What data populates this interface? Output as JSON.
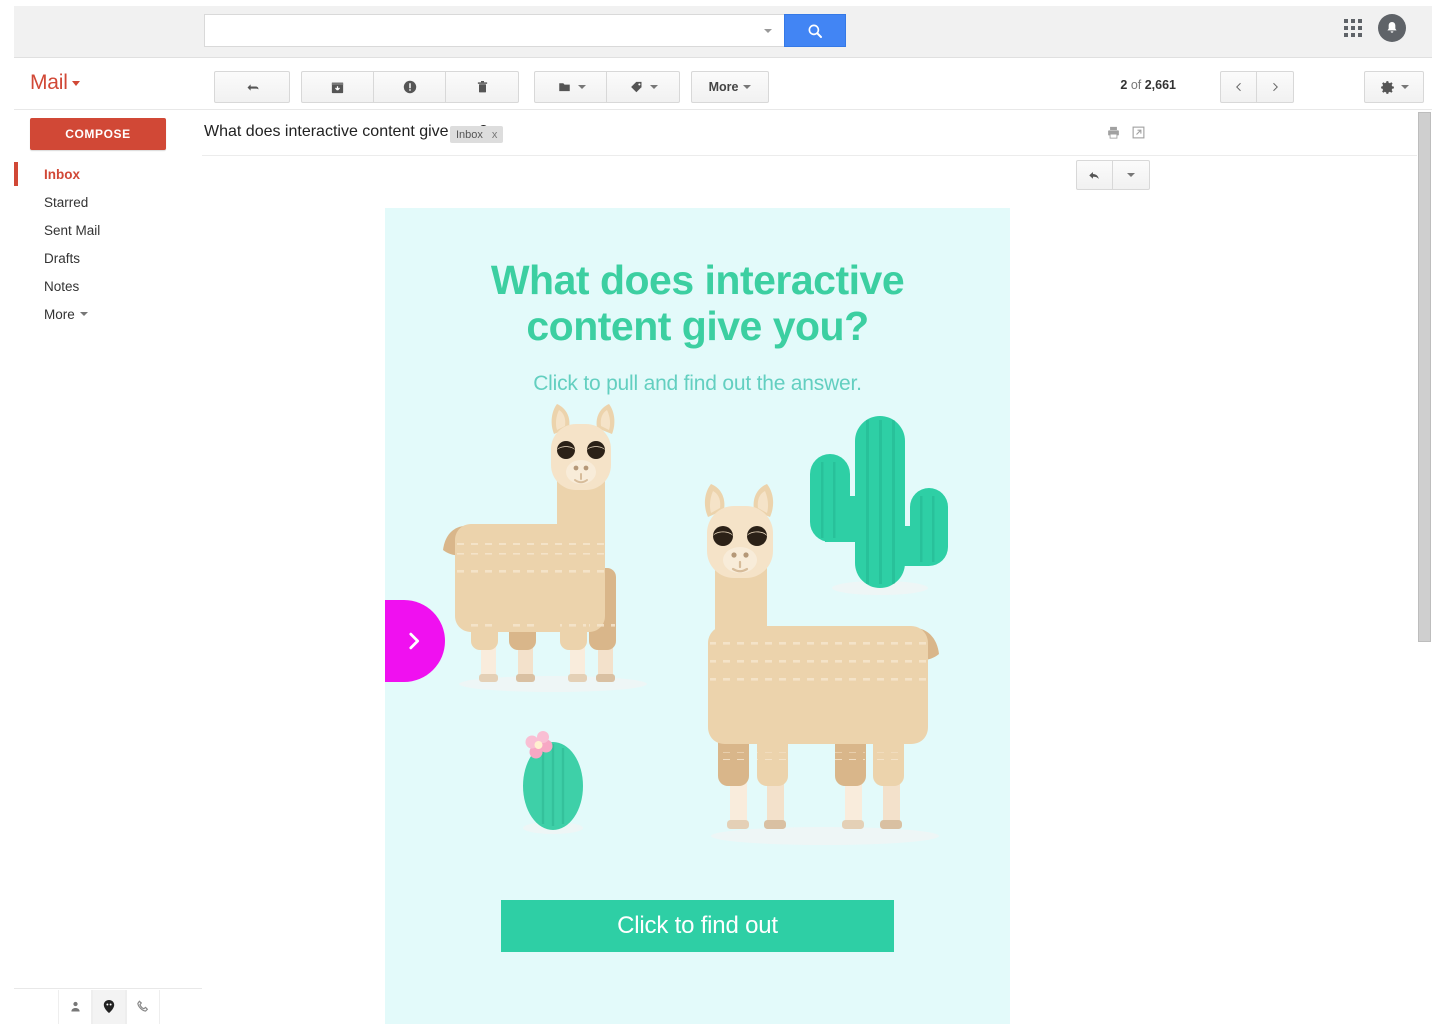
{
  "topbar": {
    "search_value": "",
    "search_placeholder": "",
    "search_button_icon": "search-icon",
    "apps_icon": "apps-grid-icon",
    "avatar_icon": "account-avatar-icon"
  },
  "mailbar": {
    "brand": "Mail",
    "buttons": [
      {
        "name": "back-to-inbox",
        "icon": "back-arrow-icon",
        "label": ""
      },
      {
        "name": "archive",
        "icon": "archive-icon",
        "label": ""
      },
      {
        "name": "report-spam",
        "icon": "exclamation-icon",
        "label": ""
      },
      {
        "name": "delete",
        "icon": "trash-icon",
        "label": ""
      },
      {
        "name": "move-to",
        "icon": "folder-icon",
        "label": ""
      },
      {
        "name": "labels",
        "icon": "tag-icon",
        "label": ""
      },
      {
        "name": "more",
        "icon": "",
        "label": "More"
      }
    ],
    "more_label": "More",
    "counter_current": "2",
    "counter_mid": " of ",
    "counter_total": "2,661",
    "prev_icon": "chevron-left-icon",
    "next_icon": "chevron-right-icon",
    "settings_icon": "gear-icon"
  },
  "sidebar": {
    "compose_label": "COMPOSE",
    "items": [
      {
        "label": "Inbox",
        "active": true
      },
      {
        "label": "Starred",
        "active": false
      },
      {
        "label": "Sent Mail",
        "active": false
      },
      {
        "label": "Drafts",
        "active": false
      },
      {
        "label": "Notes",
        "active": false
      },
      {
        "label": "More",
        "active": false,
        "caret": true
      }
    ],
    "hangouts": [
      {
        "name": "contacts-icon"
      },
      {
        "name": "chat-balloon-icon"
      },
      {
        "name": "phone-icon"
      }
    ]
  },
  "message": {
    "subject": "What does interactive content give you?",
    "label_chip": "Inbox",
    "label_chip_remove": "x",
    "print_icon": "print-icon",
    "popout_icon": "open-in-new-window-icon",
    "reply_icon": "reply-arrow-icon",
    "reply_more_icon": "chevron-down-icon"
  },
  "email": {
    "headline": "What does interactive content give you?",
    "subhead": "Click to pull and find out the answer.",
    "cta_label": "Click to find out",
    "pull_tab_icon": "chevron-right-icon",
    "colors": {
      "background": "#e3fafa",
      "headline": "#3ccfa1",
      "subhead": "#63cfc0",
      "cta_bg": "#2ecfa5",
      "cta_text": "#ffffff",
      "pull_tab": "#f010f0",
      "cactus": "#2ecfa5",
      "llama_body": "#ecd3ac",
      "llama_head": "#f5e3c8",
      "llama_dark": "#d9b68a",
      "llama_hoof": "#f7ead9",
      "flower": "#f7a8c4"
    },
    "illustration": {
      "items": [
        {
          "name": "llama-left",
          "facing": "right"
        },
        {
          "name": "llama-right",
          "facing": "left"
        },
        {
          "name": "cactus-tall"
        },
        {
          "name": "cactus-small-with-flower"
        }
      ]
    }
  }
}
